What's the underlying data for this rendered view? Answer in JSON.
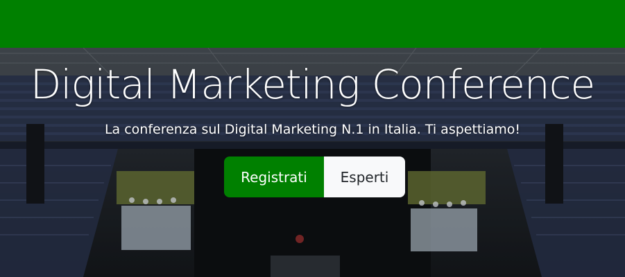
{
  "navbar": {
    "background_color": "#008000"
  },
  "hero": {
    "title": "Digital Marketing Conference",
    "subtitle": "La conferenza sul Digital Marketing N.1 in Italia. Ti aspettiamo!",
    "background_image": "stadium-stage-photo",
    "buttons": {
      "primary_label": "Registrati",
      "secondary_label": "Esperti"
    },
    "colors": {
      "primary": "#008000",
      "secondary": "#f8f9fa",
      "text": "#ffffff"
    }
  }
}
